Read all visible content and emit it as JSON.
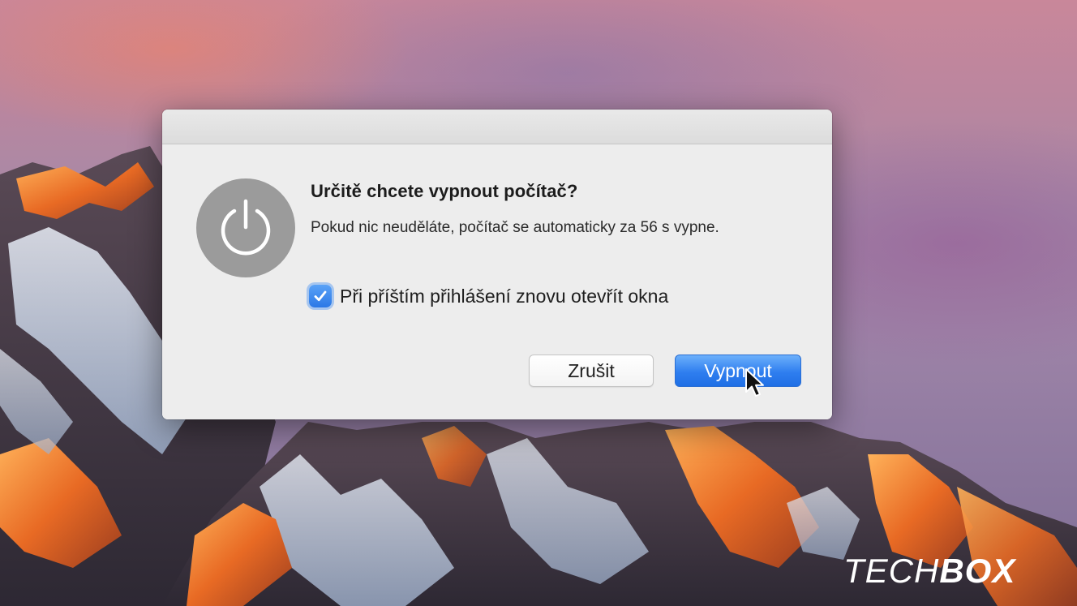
{
  "dialog": {
    "title": "Určitě chcete vypnout počítač?",
    "message": "Pokud nic neuděláte, počítač se automaticky za 56 s vypne.",
    "checkbox": {
      "label": "Při příštím přihlášení znovu otevřít okna",
      "checked": true
    },
    "buttons": {
      "cancel_label": "Zrušit",
      "confirm_label": "Vypnout"
    },
    "icon": "power-icon"
  },
  "watermark": {
    "part1": "TECH",
    "part2": "BOX"
  },
  "colors": {
    "accent": "#2f7eef",
    "dialog_bg": "#ededed",
    "power_badge": "#9b9b9b"
  }
}
